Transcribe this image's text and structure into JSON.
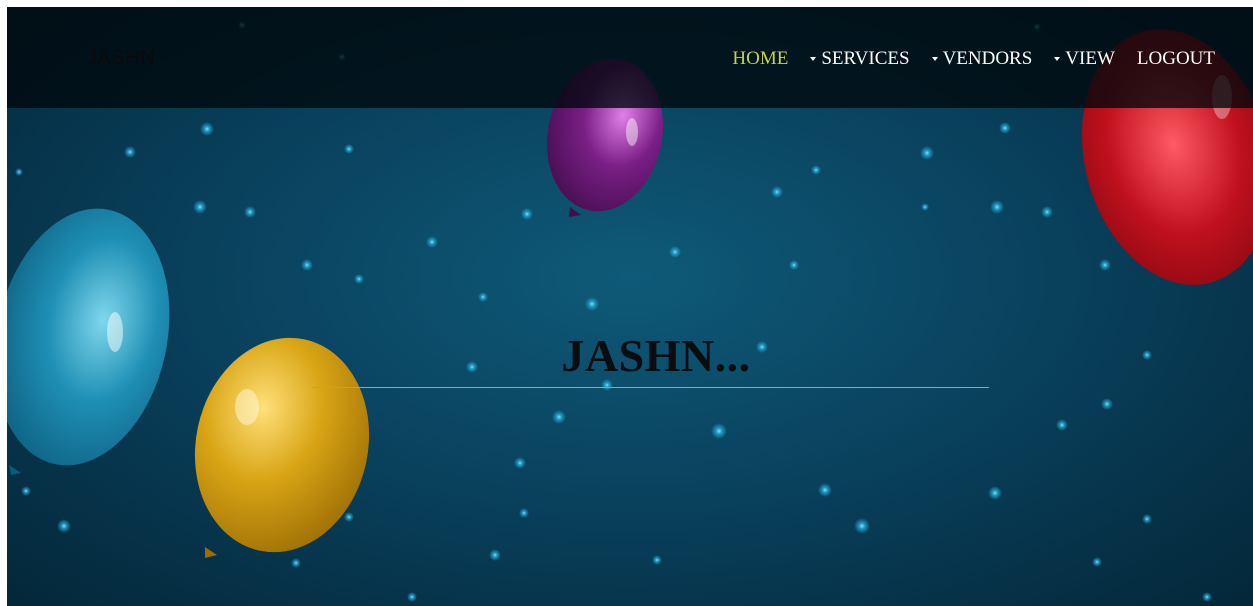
{
  "navbar": {
    "brand": "JASHN",
    "items": [
      {
        "label": "HOME",
        "active": true,
        "dropdown": false
      },
      {
        "label": "SERVICES",
        "active": false,
        "dropdown": true
      },
      {
        "label": "VENDORS",
        "active": false,
        "dropdown": true
      },
      {
        "label": "VIEW",
        "active": false,
        "dropdown": true
      },
      {
        "label": "LOGOUT",
        "active": false,
        "dropdown": false
      }
    ]
  },
  "hero": {
    "title": "JASHN..."
  },
  "colors": {
    "active_nav": "#c5d24a",
    "rule": "#c9a227",
    "background": "#0a4562"
  }
}
